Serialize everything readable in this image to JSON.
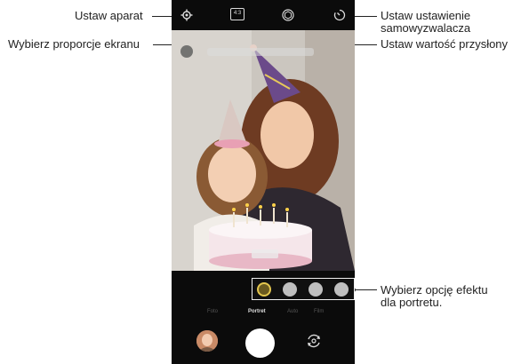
{
  "callouts": {
    "set_camera": "Ustaw aparat",
    "aspect_ratio": "Wybierz proporcje ekranu",
    "timer_line1": "Ustaw ustawienie",
    "timer_line2": "samowyzwalacza",
    "aperture": "Ustaw wartość przysłony",
    "effect_line1": "Wybierz opcję efektu",
    "effect_line2": "dla portretu."
  },
  "topbar": {
    "aspect_label": "4:3"
  },
  "modes": [
    "Foto",
    "Portret",
    "Auto",
    "Film"
  ],
  "icons": [
    "settings-icon",
    "aspect-ratio-icon",
    "aperture-icon",
    "timer-icon",
    "effect-icon",
    "switch-camera-icon"
  ],
  "colors": {
    "background": "#ffffff",
    "phone": "#0b0b0b",
    "effect_selected": "#e3c64e",
    "hat": "#6b4a8a"
  }
}
